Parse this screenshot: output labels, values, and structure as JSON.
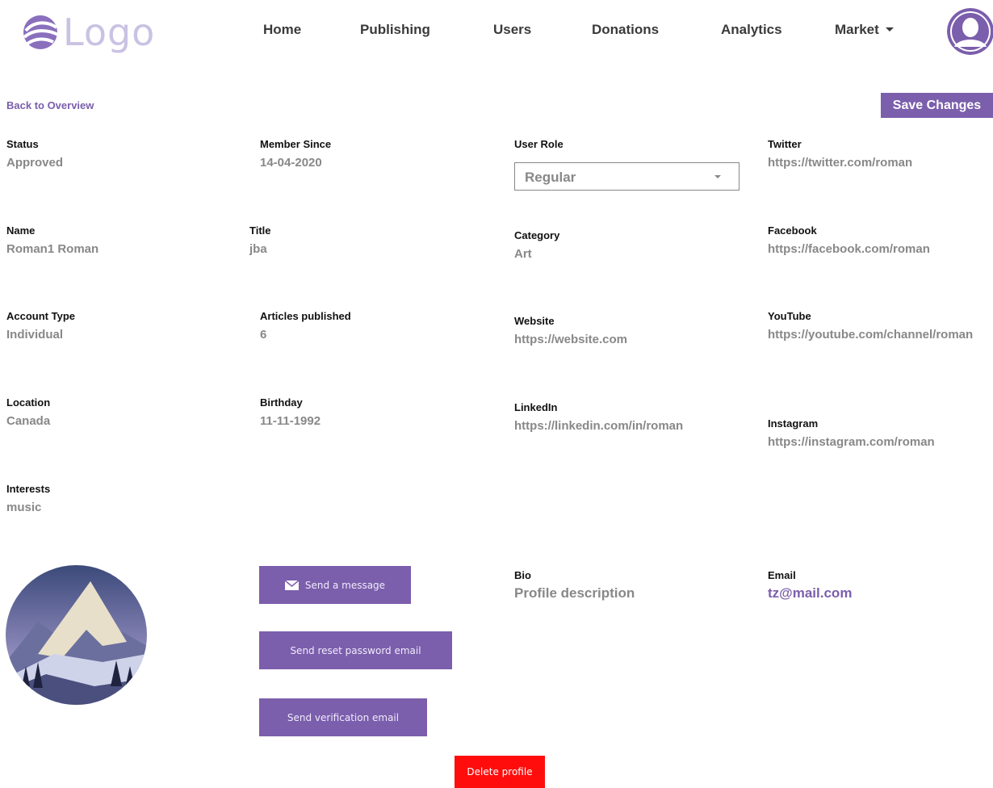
{
  "brand": {
    "logo_text": "Logo",
    "accent": "#7b5eac",
    "danger": "#ff0d0d",
    "label_color": "#888888"
  },
  "nav": {
    "home": "Home",
    "publishing": "Publishing",
    "users": "Users",
    "donations": "Donations",
    "analytics": "Analytics",
    "market": "Market"
  },
  "actions": {
    "back": "Back to Overview",
    "save": "Save Changes",
    "send_message": "Send a message",
    "reset_password": "Send reset password email",
    "verification": "Send verification email",
    "delete": "Delete profile"
  },
  "profile": {
    "status": {
      "label": "Status",
      "value": "Approved"
    },
    "member_since": {
      "label": "Member Since",
      "value": "14-04-2020"
    },
    "user_role": {
      "label": "User Role",
      "value": "Regular"
    },
    "twitter": {
      "label": "Twitter",
      "value": "https://twitter.com/roman"
    },
    "name": {
      "label": "Name",
      "value": "Roman1 Roman"
    },
    "title": {
      "label": "Title",
      "value": "jba"
    },
    "category": {
      "label": "Category",
      "value": "Art"
    },
    "facebook": {
      "label": "Facebook",
      "value": "https://facebook.com/roman"
    },
    "account_type": {
      "label": "Account Type",
      "value": "Individual"
    },
    "articles": {
      "label": "Articles published",
      "value": "6"
    },
    "website": {
      "label": "Website",
      "value": "https://website.com"
    },
    "youtube": {
      "label": "YouTube",
      "value": "https://youtube.com/channel/roman"
    },
    "location": {
      "label": "Location",
      "value": "Canada"
    },
    "birthday": {
      "label": "Birthday",
      "value": "11-11-1992"
    },
    "linkedin": {
      "label": "LinkedIn",
      "value": "https://linkedin.com/in/roman"
    },
    "instagram": {
      "label": "Instagram",
      "value": "https://instagram.com/roman"
    },
    "interests": {
      "label": "Interests",
      "value": "music"
    },
    "bio": {
      "label": "Bio",
      "value": "Profile description"
    },
    "email": {
      "label": "Email",
      "value": "tz@mail.com"
    }
  }
}
